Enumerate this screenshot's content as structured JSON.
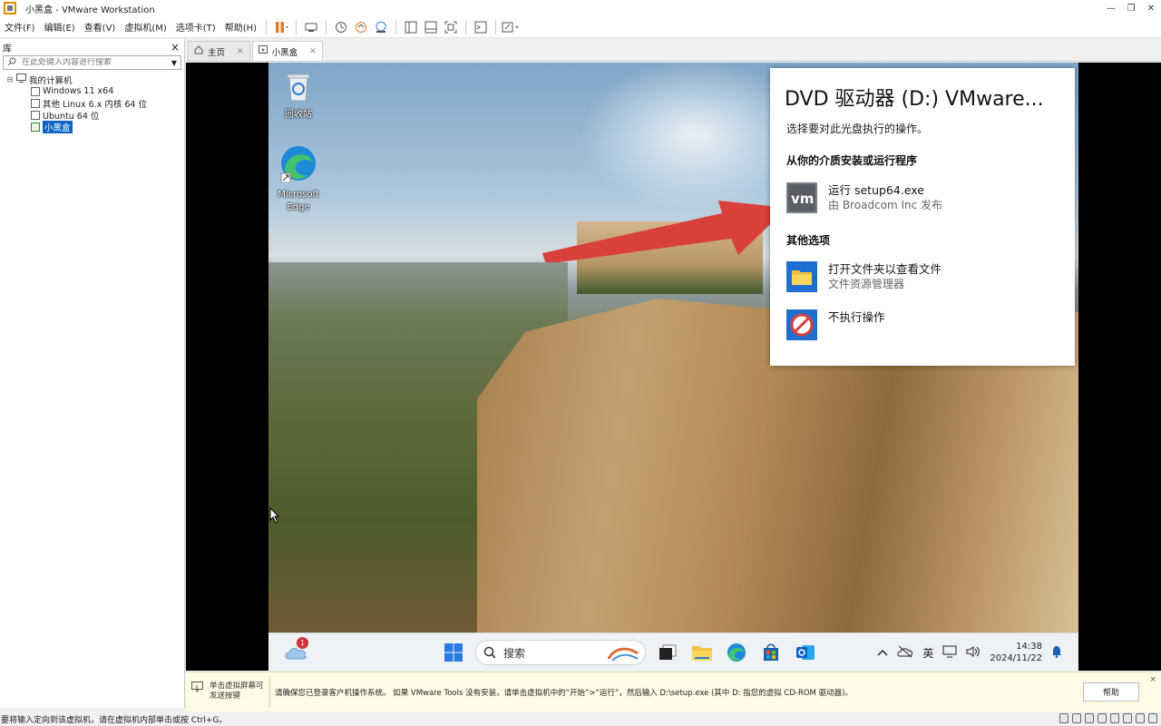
{
  "window": {
    "title": "小黑盒 - VMware Workstation",
    "controls": {
      "minimize": "—",
      "restore": "❐",
      "close": "✕"
    }
  },
  "menu": {
    "items": [
      "文件(F)",
      "编辑(E)",
      "查看(V)",
      "虚拟机(M)",
      "选项卡(T)",
      "帮助(H)"
    ]
  },
  "library": {
    "title": "库",
    "close": "×",
    "search_placeholder": "在此处键入内容进行搜索",
    "root": "我的计算机",
    "vms": [
      "Windows 11 x64",
      "其他 Linux 6.x 内核 64 位",
      "Ubuntu 64 位",
      "小黑盒"
    ],
    "selected_vm": "小黑盒"
  },
  "tabs": [
    {
      "label": "主页",
      "active": false
    },
    {
      "label": "小黑盒",
      "active": true
    }
  ],
  "desktop": {
    "icons": [
      {
        "label": "回收站",
        "icon": "recycle-bin-icon"
      },
      {
        "label": "Microsoft Edge",
        "icon": "edge-icon"
      }
    ]
  },
  "autoplay": {
    "title": "DVD 驱动器 (D:) VMware...",
    "subtitle": "选择要对此光盘执行的操作。",
    "section_install": "从你的介质安装或运行程序",
    "run_title": "运行 setup64.exe",
    "run_desc": "由 Broadcom Inc 发布",
    "section_other": "其他选项",
    "open_title": "打开文件夹以查看文件",
    "open_desc": "文件资源管理器",
    "none_title": "不执行操作"
  },
  "taskbar": {
    "weather_badge": "1",
    "search_label": "搜索",
    "ime": "英",
    "time": "14:38",
    "date": "2024/11/22"
  },
  "infobar": {
    "hint": "单击虚拟屏幕可发送按键",
    "message": "请确保您已登录客户机操作系统。 如果 VMware Tools 没有安装，请单击虚拟机中的“开始”>“运行”，然后输入 D:\\setup.exe (其中 D: 指您的虚拟 CD-ROM 驱动器)。",
    "help_button": "帮助",
    "close": "×"
  },
  "statusbar": {
    "text": "要将输入定向到该虚拟机，请在虚拟机内部单击或按 Ctrl+G。"
  },
  "colors": {
    "accent": "#0a64c8",
    "arrow": "#d9403a",
    "infobar_bg": "#fffbe6"
  }
}
